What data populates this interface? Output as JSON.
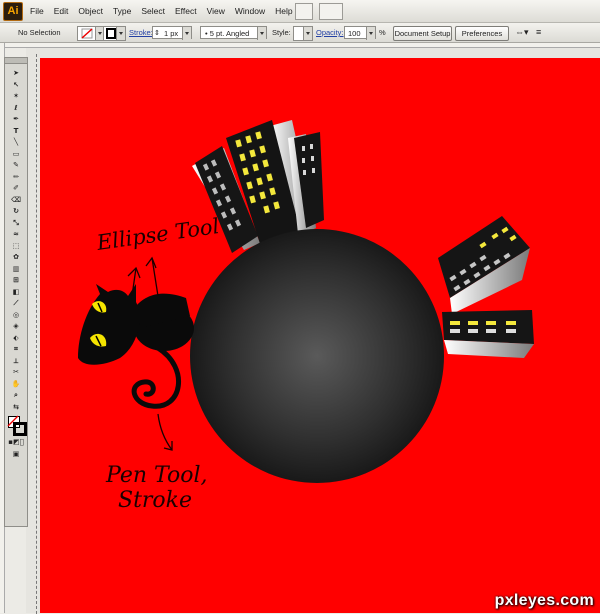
{
  "app": {
    "logo": "Ai"
  },
  "menubar": {
    "items": [
      "File",
      "Edit",
      "Object",
      "Type",
      "Select",
      "Effect",
      "View",
      "Window",
      "Help"
    ]
  },
  "options_bar": {
    "selection": "No Selection",
    "stroke_label": "Stroke:",
    "stroke_weight": "1 px",
    "brush": "5 pt. Angled",
    "style_label": "Style:",
    "opacity_label": "Opacity:",
    "opacity_value": "100",
    "percent": "%",
    "document_setup": "Document Setup",
    "preferences": "Preferences"
  },
  "annotations": {
    "ellipse_tool": "Ellipse Tool",
    "pen_tool_line1": "Pen Tool,",
    "pen_tool_line2": "Stroke"
  },
  "watermark": "pxleyes.com",
  "colors": {
    "canvas": "#ff0000",
    "planet": "#333333",
    "window_lit": "#f4e83c",
    "cat_eye": "#f5e400"
  }
}
